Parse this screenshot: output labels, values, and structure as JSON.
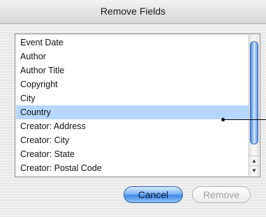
{
  "window": {
    "title": "Remove Fields"
  },
  "fields_list": {
    "items": [
      "Event Date",
      "Author",
      "Author Title",
      "Copyright",
      "City",
      "Country",
      "Creator: Address",
      "Creator: City",
      "Creator: State",
      "Creator: Postal Code"
    ],
    "selected_item": "Country"
  },
  "scrollbar": {
    "up_arrow_icon": "triangle-up",
    "down_arrow_icon": "triangle-down"
  },
  "buttons": {
    "cancel_label": "Cancel",
    "remove_label": "Remove",
    "remove_enabled": false
  },
  "colors": {
    "selection": "#b6d6fd",
    "default_button": "#3f87e8"
  }
}
